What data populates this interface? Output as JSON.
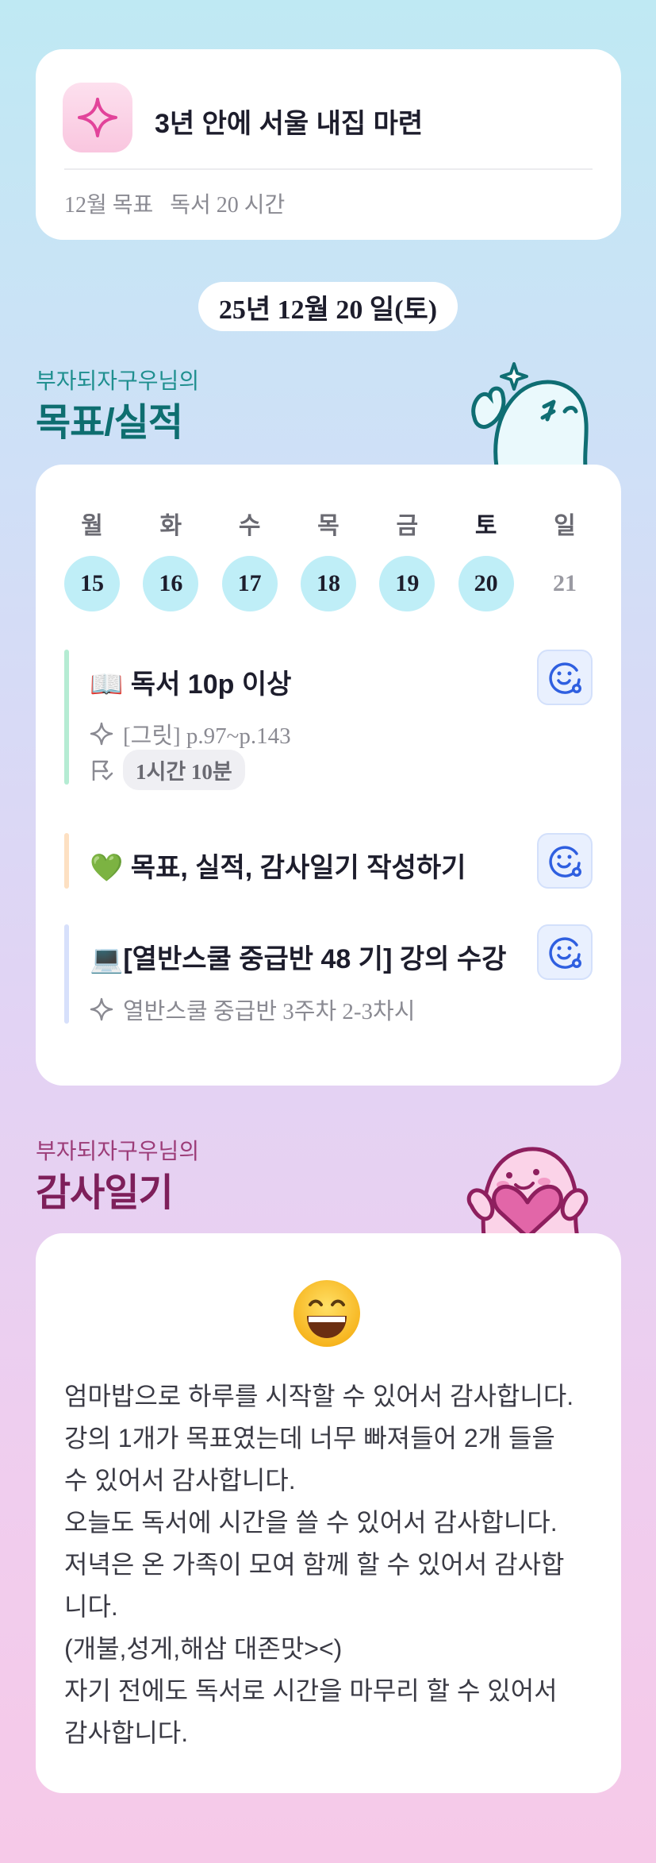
{
  "goal": {
    "title": "3년 안에 서울 내집 마련",
    "monthly_label": "12월 목표",
    "monthly_value": "독서 20 시간"
  },
  "date": "25년 12월 20 일(토)",
  "goals_section": {
    "subtitle": "부자되자구우님의",
    "title": "목표/실적"
  },
  "week": {
    "days": [
      {
        "name": "월",
        "num": "15",
        "filled": true
      },
      {
        "name": "화",
        "num": "16",
        "filled": true
      },
      {
        "name": "수",
        "num": "17",
        "filled": true
      },
      {
        "name": "목",
        "num": "18",
        "filled": true
      },
      {
        "name": "금",
        "num": "19",
        "filled": true
      },
      {
        "name": "토",
        "num": "20",
        "filled": true,
        "today": true
      },
      {
        "name": "일",
        "num": "21",
        "filled": false
      }
    ]
  },
  "tasks": [
    {
      "emoji": "📖",
      "title": " 독서 10p 이상",
      "note": "[그릿] p.97~p.143",
      "time": "1시간 10분",
      "bar_color": "#b5ecd3"
    },
    {
      "emoji": "💚",
      "title": " 목표, 실적, 감사일기 작성하기",
      "bar_color": "#fde0c2"
    },
    {
      "emoji": "💻",
      "title": "[열반스쿨 중급반 48 기] 강의 수강",
      "note": "열반스쿨 중급반 3주차 2-3차시",
      "bar_color": "#d7e0fb"
    }
  ],
  "gratitude_section": {
    "subtitle": "부자되자구우님의",
    "title": "감사일기"
  },
  "gratitude": {
    "lines": [
      "엄마밥으로 하루를 시작할 수 있어서 감사합니다.",
      "강의 1개가 목표였는데 너무 빠져들어 2개 들을",
      "수 있어서 감사합니다.",
      "오늘도 독서에 시간을 쓸 수  있어서 감사합니다.",
      "저녁은 온 가족이 모여 함께 할 수 있어서 감사합",
      "니다.",
      "(개불,성게,해삼 대존맛><)",
      "자기 전에도 독서로 시간을 마무리 할 수 있어서",
      "감사합니다."
    ]
  },
  "icons": {
    "goal": "sparkle-icon",
    "task_action": "smile-face-icon",
    "note": "sparkle-outline-icon",
    "time": "flag-icon",
    "mood": "grinning-face-emoji"
  }
}
